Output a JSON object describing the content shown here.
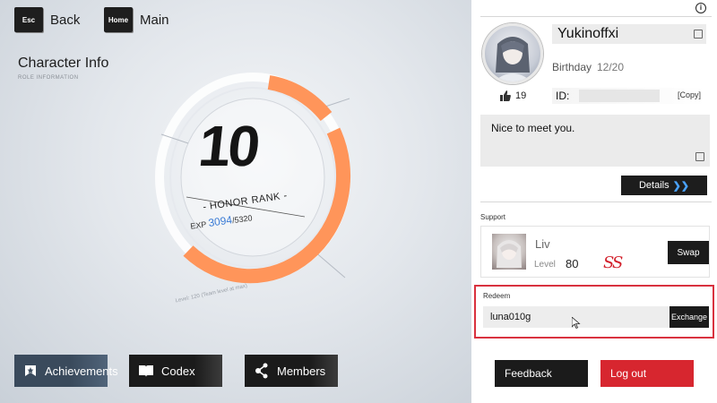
{
  "hud": {
    "back_key": "Esc",
    "back_label": "Back",
    "main_key": "Home",
    "main_label": "Main"
  },
  "page": {
    "title": "Character Info",
    "subtitle": "ROLE INFORMATION"
  },
  "honor": {
    "rank": "10",
    "label": "- HONOR RANK -",
    "exp_label": "EXP",
    "exp_current": "3094",
    "exp_max": "/5320",
    "exp_fraction": 0.58,
    "note": "Level: 120 (Team level at max)"
  },
  "bottom_nav": [
    {
      "label": "Achievements",
      "icon": "achievement-icon"
    },
    {
      "label": "Codex",
      "icon": "book-icon"
    },
    {
      "label": "Members",
      "icon": "network-icon"
    }
  ],
  "profile": {
    "name": "Yukinoffxi",
    "birthday_label": "Birthday",
    "birthday_value": "12/20",
    "likes": "19",
    "id_label": "ID:",
    "copy_label": "[Copy]",
    "bio": "Nice to meet you.",
    "details_label": "Details"
  },
  "support": {
    "section_label": "Support",
    "name": "Liv",
    "level_label": "Level",
    "level": "80",
    "rank": "SS",
    "swap_label": "Swap"
  },
  "redeem": {
    "section_label": "Redeem",
    "input_value": "luna010g",
    "exchange_label": "Exchange"
  },
  "footer": {
    "feedback_label": "Feedback",
    "logout_label": "Log out"
  },
  "colors": {
    "accent_orange": "#ff955a",
    "exp_blue": "#3a7bd5",
    "logout_red": "#d7262f",
    "highlight_red": "#d9323f"
  }
}
